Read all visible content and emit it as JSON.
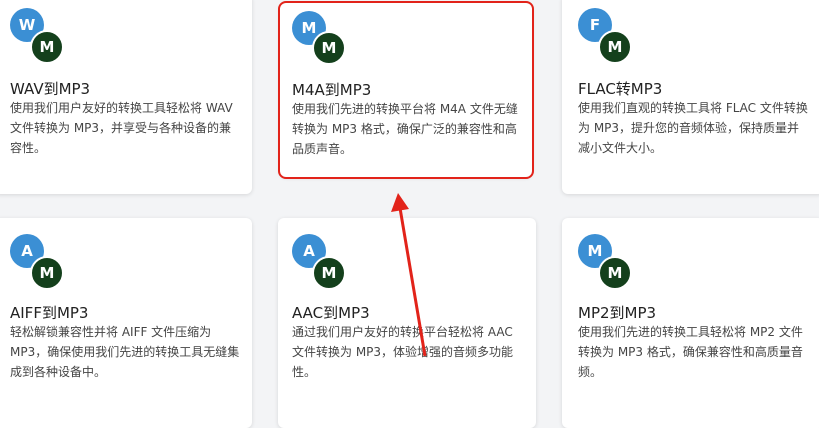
{
  "cards": [
    {
      "from": "W",
      "to": "M",
      "title": "WAV到MP3",
      "desc": "使用我们用户友好的转换工具轻松将 WAV 文件转换为 MP3，并享受与各种设备的兼容性。"
    },
    {
      "from": "M",
      "to": "M",
      "title": "M4A到MP3",
      "desc": "使用我们先进的转换平台将 M4A 文件无缝转换为 MP3 格式，确保广泛的兼容性和高品质声音。"
    },
    {
      "from": "F",
      "to": "M",
      "title": "FLAC转MP3",
      "desc": "使用我们直观的转换工具将 FLAC 文件转换为 MP3，提升您的音频体验，保持质量并减小文件大小。"
    },
    {
      "from": "A",
      "to": "M",
      "title": "AIFF到MP3",
      "desc": "轻松解锁兼容性并将 AIFF 文件压缩为 MP3，确保使用我们先进的转换工具无缝集成到各种设备中。"
    },
    {
      "from": "A",
      "to": "M",
      "title": "AAC到MP3",
      "desc": "通过我们用户友好的转换平台轻松将 AAC 文件转换为 MP3，体验增强的音频多功能性。"
    },
    {
      "from": "M",
      "to": "M",
      "title": "MP2到MP3",
      "desc": "使用我们先进的转换工具轻松将 MP2 文件转换为 MP3 格式，确保兼容性和高质量音频。"
    }
  ],
  "colors": {
    "from_badge": "#3b8fd4",
    "to_badge": "#14401c",
    "highlight": "#e2231a"
  },
  "annotation": {
    "highlighted_card": "M4A到MP3",
    "icon": "red-arrow-icon"
  }
}
